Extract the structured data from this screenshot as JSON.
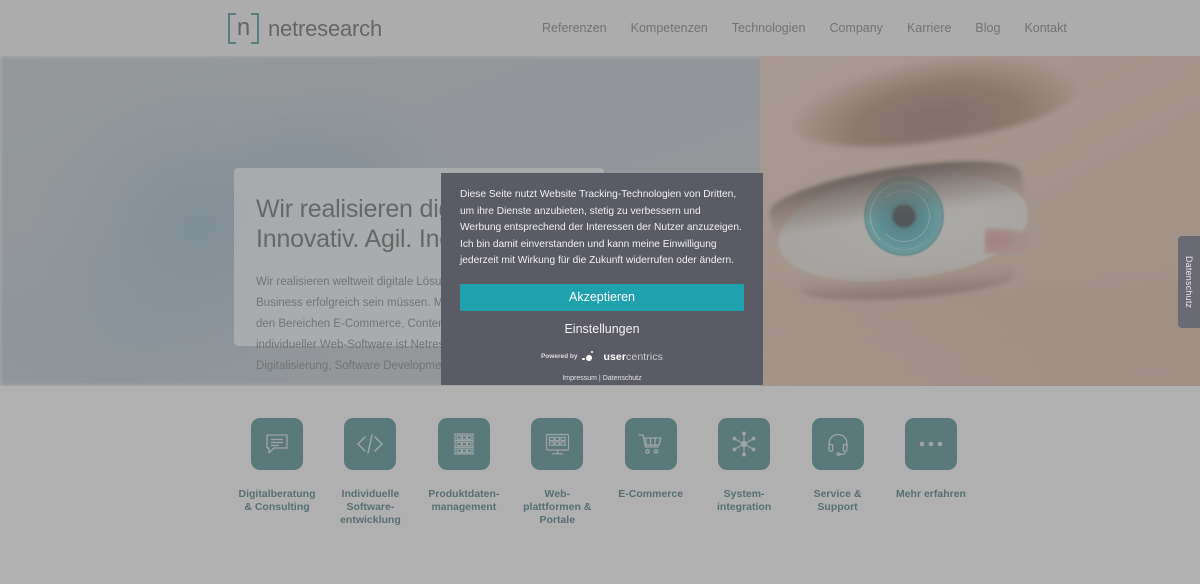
{
  "header": {
    "logo_bracket_char": "n",
    "logo_text": "netresearch",
    "nav": [
      {
        "label": "Referenzen"
      },
      {
        "label": "Kompetenzen"
      },
      {
        "label": "Technologien"
      },
      {
        "label": "Company"
      },
      {
        "label": "Karriere"
      },
      {
        "label": "Blog"
      },
      {
        "label": "Kontakt"
      }
    ]
  },
  "hero": {
    "headline_line1": "Wir realisieren digitale Visionen.",
    "headline_line2": "Innovativ. Agil. Individuell.",
    "paragraph_lines": [
      "Wir realisieren weltweit digitale Lösungen f",
      "Business erfolgreich sein müssen. Mit meh",
      "den Bereichen E-Commerce, Content-Mana",
      "individueller Web-Software ist Netresearch",
      "Digitalisierung, Software Development und"
    ]
  },
  "side_tab": {
    "label": "Datenschutz"
  },
  "services": [
    {
      "icon": "speech-bubble-icon",
      "label": "Digitalberatung\n& Consulting"
    },
    {
      "icon": "code-brackets-icon",
      "label": "Individuelle\nSoftware-\nentwicklung"
    },
    {
      "icon": "shelf-rack-icon",
      "label": "Produktdaten-\nmanagement"
    },
    {
      "icon": "monitor-grid-icon",
      "label": "Web-\nplattformen &\nPortale"
    },
    {
      "icon": "shopping-cart-icon",
      "label": "E-Commerce"
    },
    {
      "icon": "network-hub-icon",
      "label": "System-\nintegration"
    },
    {
      "icon": "headset-icon",
      "label": "Service &\nSupport"
    },
    {
      "icon": "ellipsis-icon",
      "label": "Mehr erfahren"
    }
  ],
  "cookie_modal": {
    "body": "Diese Seite nutzt Website Tracking-Technologien von Dritten, um ihre Dienste anzubieten, stetig zu verbessern und Werbung entsprechend der Interessen der Nutzer anzuzeigen. Ich bin damit einverstanden und kann meine Einwilligung jederzeit mit Wirkung für die Zukunft widerrufen oder ändern.",
    "accept_label": "Akzeptieren",
    "settings_label": "Einstellungen",
    "powered_by_label": "Powered by",
    "vendor_name_strong": "user",
    "vendor_name_light": "centrics",
    "legal_imprint": "Impressum",
    "legal_separator": " | ",
    "legal_privacy": "Datenschutz"
  },
  "colors": {
    "brand_teal": "#1b6e74",
    "accept_button": "#1fa2ad",
    "modal_bg": "#5a5b64",
    "label_teal": "#12565c"
  }
}
